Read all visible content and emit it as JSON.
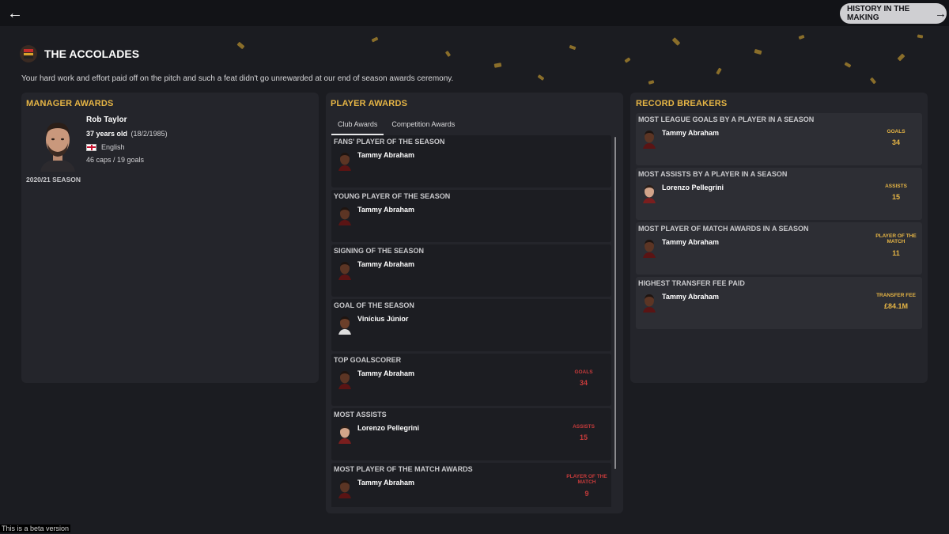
{
  "topbar": {
    "history_label": "HISTORY IN THE MAKING"
  },
  "header": {
    "title": "THE ACCOLADES",
    "subtitle": "Your hard work and effort paid off on the pitch and such a feat didn't go unrewarded at our end of season awards ceremony."
  },
  "manager_awards": {
    "title": "MANAGER AWARDS",
    "name": "Rob Taylor",
    "age": "37 years old",
    "dob": "(18/2/1985)",
    "nationality": "English",
    "caps": "46 caps / 19 goals",
    "season": "2020/21 SEASON"
  },
  "player_awards": {
    "title": "PLAYER AWARDS",
    "tabs": [
      "Club Awards",
      "Competition Awards"
    ],
    "active_tab": "Club Awards",
    "cards": [
      {
        "title": "FANS' PLAYER OF THE SEASON",
        "player": "Tammy Abraham"
      },
      {
        "title": "YOUNG PLAYER OF THE SEASON",
        "player": "Tammy Abraham"
      },
      {
        "title": "SIGNING OF THE SEASON",
        "player": "Tammy Abraham"
      },
      {
        "title": "GOAL OF THE SEASON",
        "player": "Vinícius Júnior"
      },
      {
        "title": "TOP GOALSCORER",
        "player": "Tammy Abraham",
        "stat_label": "GOALS",
        "stat_value": "34"
      },
      {
        "title": "MOST ASSISTS",
        "player": "Lorenzo Pellegrini",
        "stat_label": "ASSISTS",
        "stat_value": "15"
      },
      {
        "title": "MOST PLAYER OF THE MATCH AWARDS",
        "player": "Tammy Abraham",
        "stat_label": "PLAYER OF THE MATCH",
        "stat_value": "9"
      }
    ]
  },
  "record_breakers": {
    "title": "RECORD BREAKERS",
    "cards": [
      {
        "title": "MOST LEAGUE GOALS BY A PLAYER IN A SEASON",
        "player": "Tammy Abraham",
        "stat_label": "GOALS",
        "stat_value": "34"
      },
      {
        "title": "MOST ASSISTS BY A PLAYER IN A SEASON",
        "player": "Lorenzo Pellegrini",
        "stat_label": "ASSISTS",
        "stat_value": "15"
      },
      {
        "title": "MOST PLAYER OF MATCH AWARDS IN A SEASON",
        "player": "Tammy Abraham",
        "stat_label": "PLAYER OF THE MATCH",
        "stat_value": "11"
      },
      {
        "title": "HIGHEST TRANSFER FEE PAID",
        "player": "Tammy Abraham",
        "stat_label": "TRANSFER FEE",
        "stat_value": "£84.1M"
      }
    ]
  },
  "footer": {
    "beta_label": "This is a beta version"
  },
  "colors": {
    "accent_gold": "#e6b545",
    "stat_red": "#c73b3b",
    "background": "#1b1c21"
  }
}
